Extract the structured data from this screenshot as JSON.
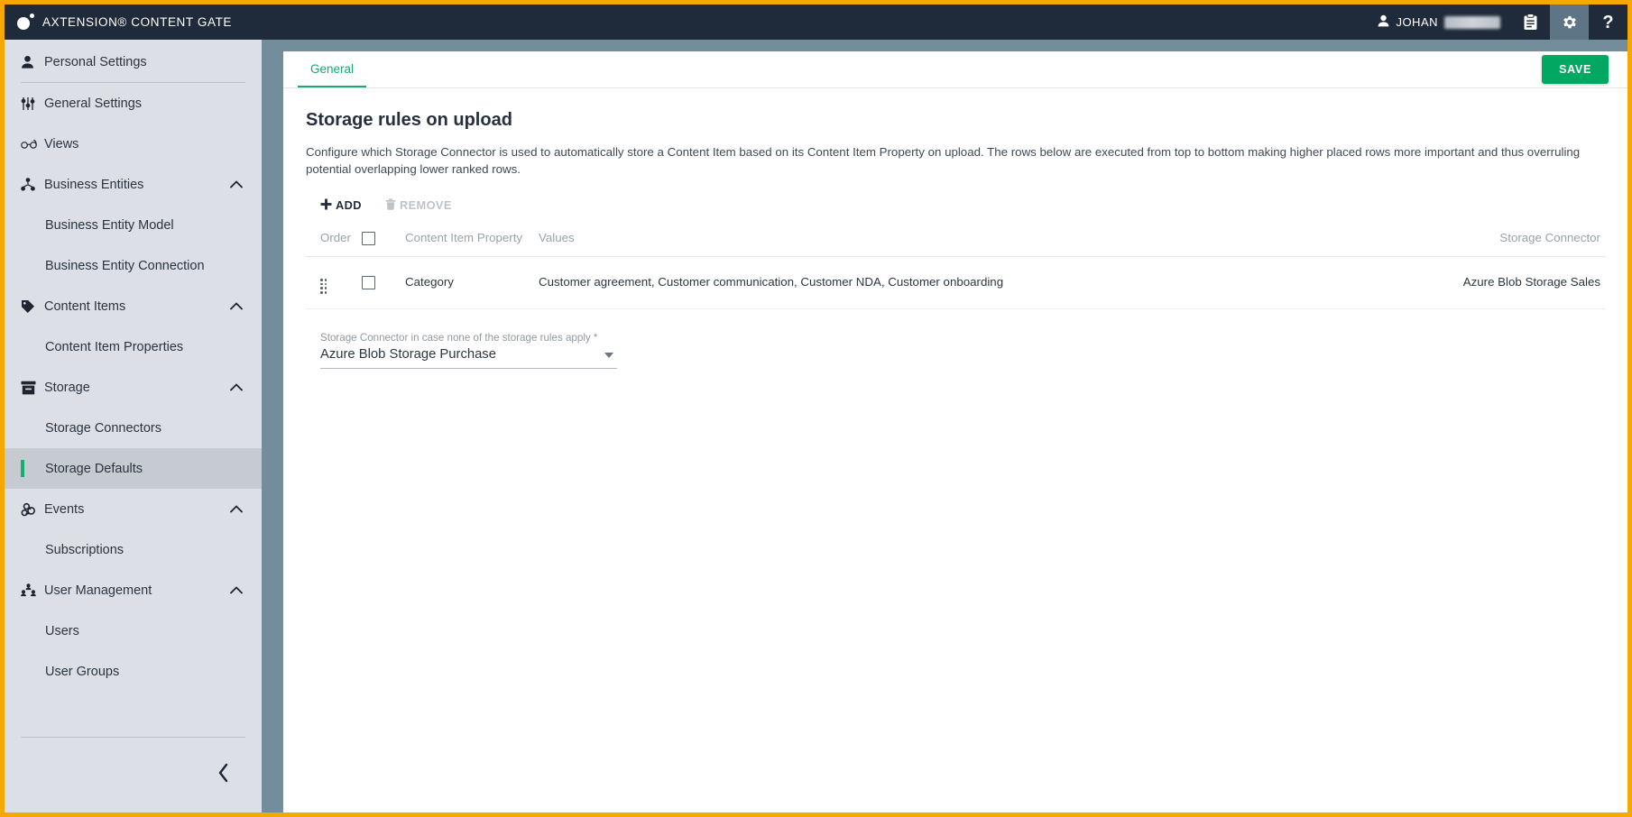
{
  "topbar": {
    "brand": "AXTENSION® CONTENT GATE",
    "logo_icon": "axtension-logo-icon",
    "user_icon": "user-icon",
    "user_name": "JOHAN",
    "user_redacted": "",
    "clipboard_icon": "clipboard-icon",
    "settings_icon": "gear-icon",
    "help_icon": "question-mark-icon"
  },
  "sidebar": {
    "items": [
      {
        "label": "Personal Settings",
        "icon": "person-icon",
        "level": "top",
        "expandable": false,
        "selected": false
      },
      {
        "label": "General Settings",
        "icon": "sliders-icon",
        "level": "top",
        "expandable": false,
        "selected": false
      },
      {
        "label": "Views",
        "icon": "glasses-icon",
        "level": "top",
        "expandable": false,
        "selected": false
      },
      {
        "label": "Business Entities",
        "icon": "hierarchy-icon",
        "level": "top",
        "expandable": true,
        "expanded": true,
        "selected": false
      },
      {
        "label": "Business Entity Model",
        "icon": "",
        "level": "child",
        "expandable": false,
        "selected": false
      },
      {
        "label": "Business Entity Connection",
        "icon": "",
        "level": "child",
        "expandable": false,
        "selected": false
      },
      {
        "label": "Content Items",
        "icon": "tag-icon",
        "level": "top",
        "expandable": true,
        "expanded": true,
        "selected": false
      },
      {
        "label": "Content Item Properties",
        "icon": "",
        "level": "child",
        "expandable": false,
        "selected": false
      },
      {
        "label": "Storage",
        "icon": "archive-box-icon",
        "level": "top",
        "expandable": true,
        "expanded": true,
        "selected": false
      },
      {
        "label": "Storage Connectors",
        "icon": "",
        "level": "child",
        "expandable": false,
        "selected": false
      },
      {
        "label": "Storage Defaults",
        "icon": "",
        "level": "child",
        "expandable": false,
        "selected": true
      },
      {
        "label": "Events",
        "icon": "webhook-icon",
        "level": "top",
        "expandable": true,
        "expanded": true,
        "selected": false
      },
      {
        "label": "Subscriptions",
        "icon": "",
        "level": "child",
        "expandable": false,
        "selected": false
      },
      {
        "label": "User Management",
        "icon": "users-group-icon",
        "level": "top",
        "expandable": true,
        "expanded": true,
        "selected": false
      },
      {
        "label": "Users",
        "icon": "",
        "level": "child",
        "expandable": false,
        "selected": false
      },
      {
        "label": "User Groups",
        "icon": "",
        "level": "child",
        "expandable": false,
        "selected": false
      }
    ],
    "collapse_icon": "chevron-left-icon"
  },
  "main": {
    "tabs": [
      {
        "label": "General",
        "active": true
      }
    ],
    "save_label": "SAVE",
    "page_title": "Storage rules on upload",
    "page_description": "Configure which Storage Connector is used to automatically store a Content Item based on its Content Item Property on upload. The rows below are executed from top to bottom making higher placed rows more important and thus overruling potential overlapping lower ranked rows.",
    "toolbar": {
      "add_label": "ADD",
      "add_icon": "plus-icon",
      "remove_label": "REMOVE",
      "remove_icon": "trash-icon",
      "remove_disabled": true
    },
    "table": {
      "headers": {
        "order": "Order",
        "select_all": "",
        "property": "Content Item Property",
        "values": "Values",
        "connector": "Storage Connector"
      },
      "rows": [
        {
          "drag_handle": "drag-handle-icon",
          "checked": false,
          "property": "Category",
          "values": "Customer agreement, Customer communication, Customer NDA, Customer onboarding",
          "connector": "Azure Blob Storage Sales"
        }
      ]
    },
    "fallback_field": {
      "label": "Storage Connector in case none of the storage rules apply *",
      "value": "Azure Blob Storage Purchase",
      "caret_icon": "chevron-down-icon"
    }
  },
  "colors": {
    "topbar_bg": "#1f2b3a",
    "page_bg": "#748d9d",
    "sidebar_bg": "#dcdfe6",
    "sidebar_selected_bg": "#c6cbd2",
    "accent_green": "#00a862",
    "tab_green": "#16a971",
    "selected_marker_green": "#13b06e",
    "frame_orange": "#f5a800"
  }
}
